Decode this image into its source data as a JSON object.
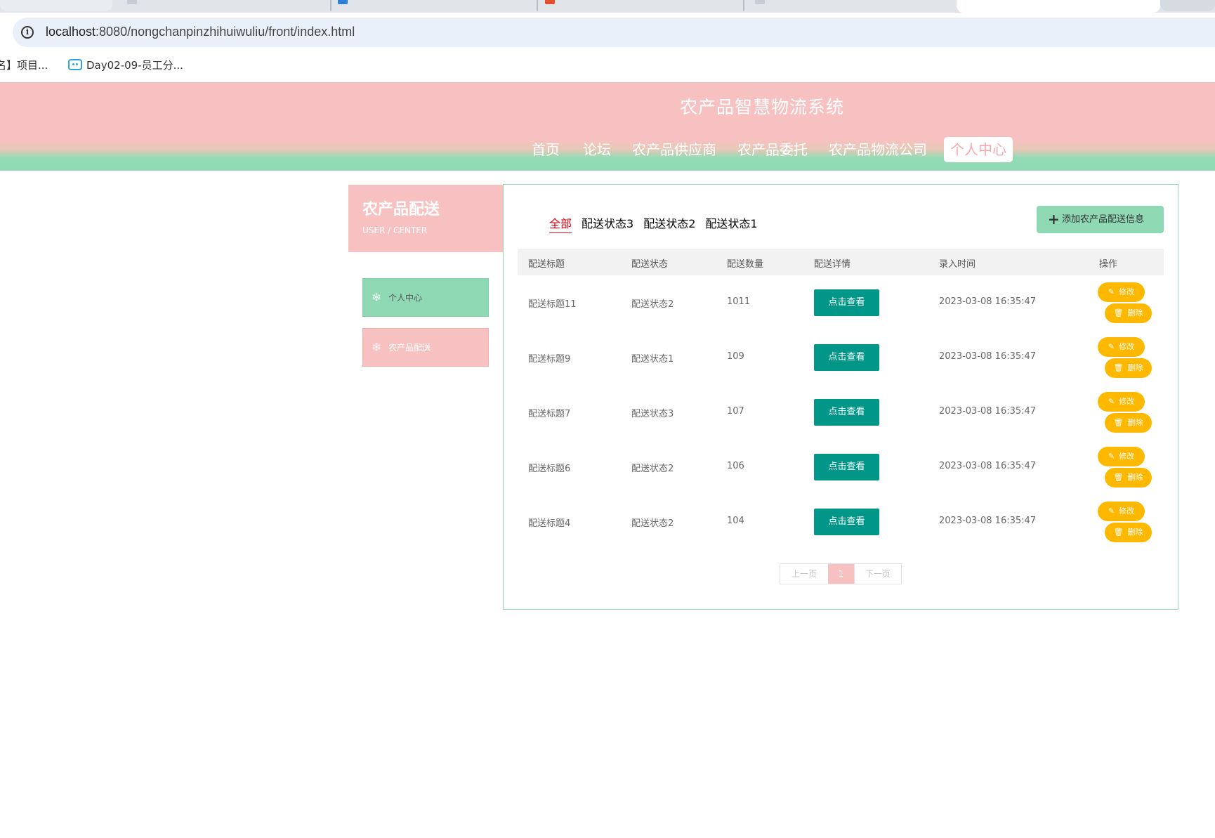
{
  "browser": {
    "url_host": "localhost",
    "url_path": ":8080/nongchanpinzhihuiwuliu/front/index.html",
    "bookmarks": [
      {
        "label": "名】项目..."
      },
      {
        "label": "Day02-09-员工分..."
      }
    ]
  },
  "header": {
    "title": "农产品智慧物流系统",
    "nav": [
      "首页",
      "论坛",
      "农产品供应商",
      "农产品委托",
      "农产品物流公司",
      "个人中心"
    ]
  },
  "sidebar": {
    "title": "农产品配送",
    "subtitle": "USER / CENTER",
    "items": [
      "个人中心",
      "农产品配送"
    ]
  },
  "main": {
    "filters": [
      "全部",
      "配送状态3",
      "配送状态2",
      "配送状态1"
    ],
    "add_button": "添加农产品配送信息",
    "columns": [
      "配送标题",
      "配送状态",
      "配送数量",
      "配送详情",
      "录入时间",
      "操作"
    ],
    "rows": [
      {
        "title": "配送标题11",
        "status": "配送状态2",
        "qty": "1011",
        "detail": "点击查看",
        "time": "2023-03-08 16:35:47",
        "edit": "修改",
        "delete": "删除"
      },
      {
        "title": "配送标题9",
        "status": "配送状态1",
        "qty": "109",
        "detail": "点击查看",
        "time": "2023-03-08 16:35:47",
        "edit": "修改",
        "delete": "删除"
      },
      {
        "title": "配送标题7",
        "status": "配送状态3",
        "qty": "107",
        "detail": "点击查看",
        "time": "2023-03-08 16:35:47",
        "edit": "修改",
        "delete": "删除"
      },
      {
        "title": "配送标题6",
        "status": "配送状态2",
        "qty": "106",
        "detail": "点击查看",
        "time": "2023-03-08 16:35:47",
        "edit": "修改",
        "delete": "删除"
      },
      {
        "title": "配送标题4",
        "status": "配送状态2",
        "qty": "104",
        "detail": "点击查看",
        "time": "2023-03-08 16:35:47",
        "edit": "修改",
        "delete": "删除"
      }
    ],
    "pager": {
      "prev": "上一页",
      "current": "1",
      "next": "下一页"
    }
  },
  "colors": {
    "pink": "#f7c1c1",
    "green": "#8ed9b4",
    "teal": "#009688",
    "amber": "#ffb800",
    "active_filter": "#e60012"
  }
}
